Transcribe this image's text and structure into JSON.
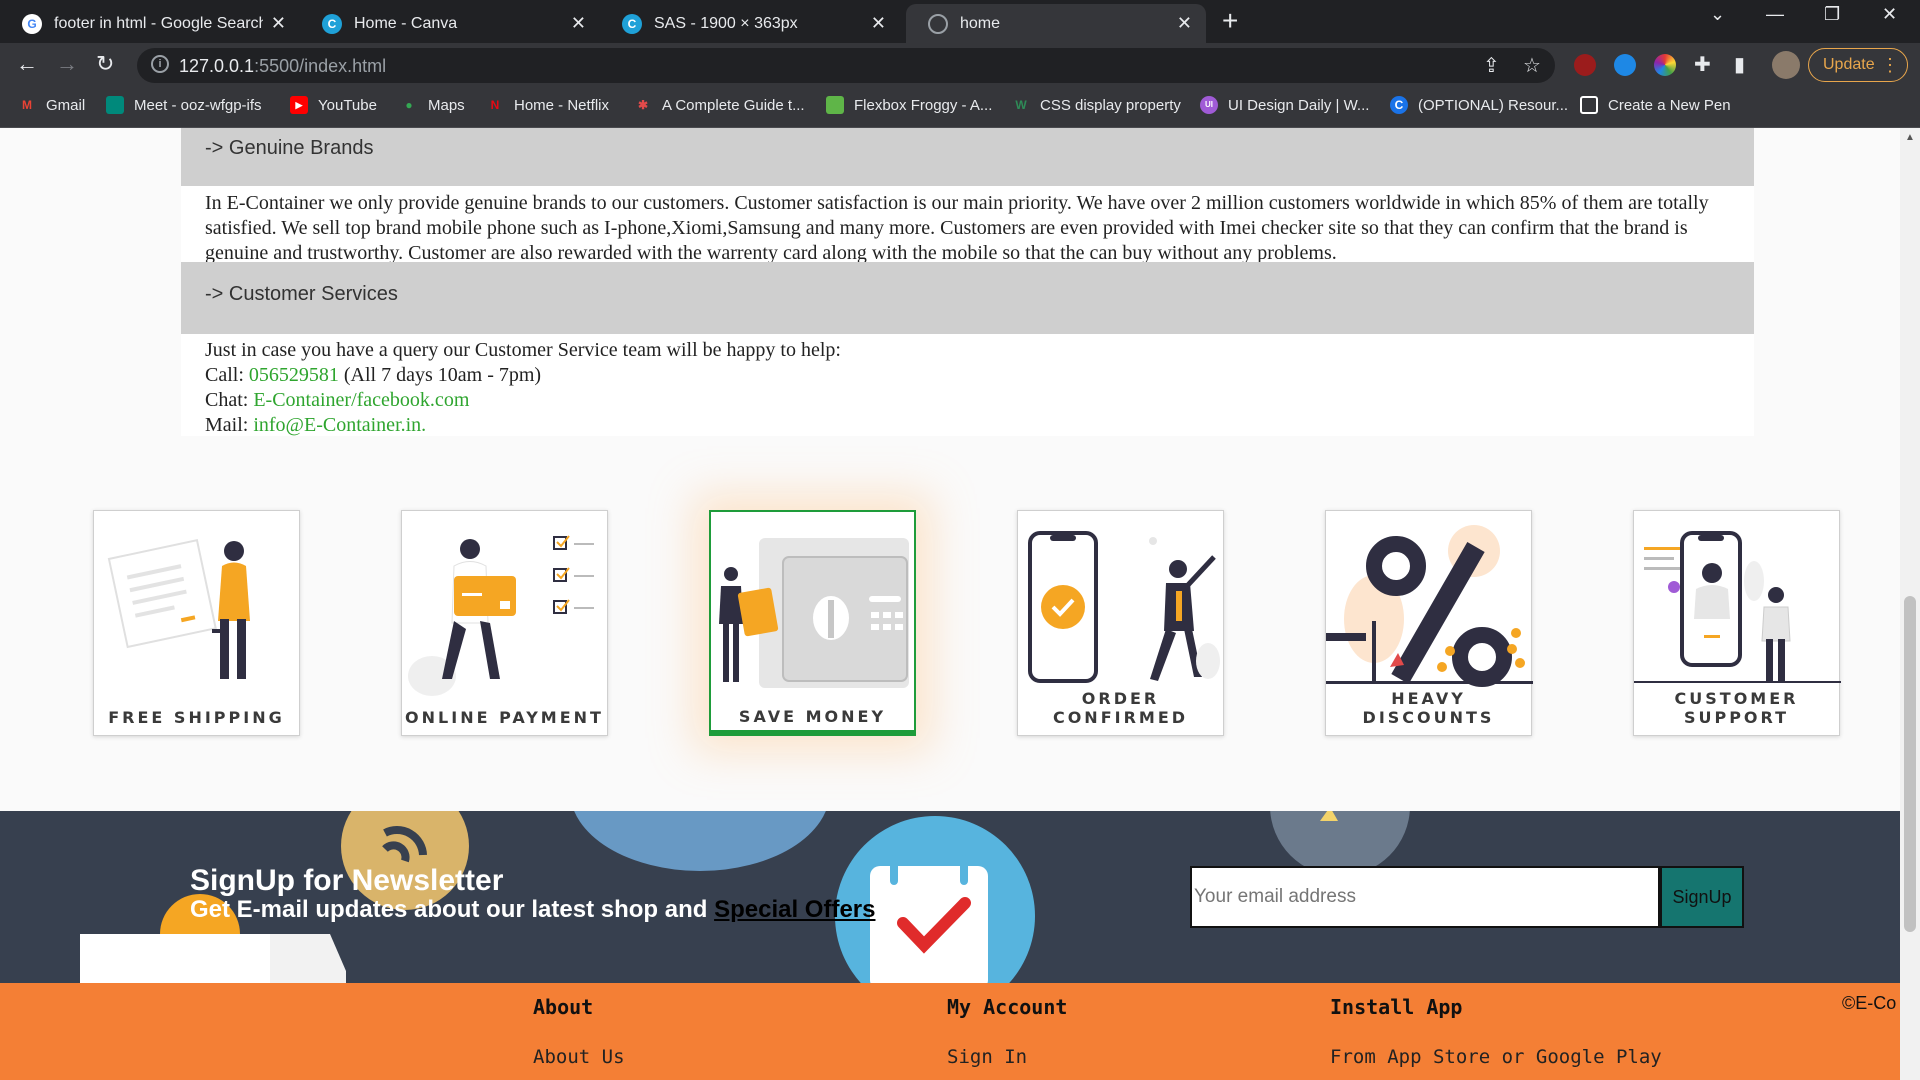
{
  "browser": {
    "tabs": [
      {
        "title": "footer in html - Google Search",
        "icon": "google-icon"
      },
      {
        "title": "Home - Canva",
        "icon": "canva-icon"
      },
      {
        "title": "SAS - 1900 × 363px",
        "icon": "canva-icon"
      },
      {
        "title": "home",
        "icon": "globe-icon",
        "active": true
      }
    ],
    "url_host": "127.0.0.1",
    "url_rest": ":5500/index.html",
    "update_label": "Update",
    "bookmarks": [
      {
        "label": "Gmail",
        "icon": "gmail-icon",
        "color": "#ea4335"
      },
      {
        "label": "Meet - ooz-wfgp-ifs",
        "icon": "meet-icon",
        "color": "#00897b"
      },
      {
        "label": "YouTube",
        "icon": "youtube-icon",
        "color": "#ff0000"
      },
      {
        "label": "Maps",
        "icon": "maps-icon",
        "color": "#34a853"
      },
      {
        "label": "Home - Netflix",
        "icon": "netflix-icon",
        "color": "#e50914"
      },
      {
        "label": "A Complete Guide t...",
        "icon": "asterisk-icon",
        "color": "#e24a4a"
      },
      {
        "label": "Flexbox Froggy - A...",
        "icon": "frog-icon",
        "color": "#5fb548"
      },
      {
        "label": "CSS display property",
        "icon": "w-icon",
        "color": "#2e8b57"
      },
      {
        "label": "UI Design Daily | W...",
        "icon": "ui-icon",
        "color": "#a05bd6"
      },
      {
        "label": "(OPTIONAL) Resour...",
        "icon": "c-icon",
        "color": "#1a73e8"
      },
      {
        "label": "Create a New Pen",
        "icon": "codepen-icon",
        "color": "#ffffff"
      }
    ]
  },
  "faq": {
    "genuine": {
      "title": "-> Genuine Brands",
      "body": "In E-Container we only provide genuine brands to our customers. Customer satisfaction is our main priority. We have over 2 million customers worldwide in which 85% of them are totally satisfied. We sell top brand mobile phone such as I-phone,Xiomi,Samsung and many more. Customers are even provided with Imei checker site so that they can confirm that the brand is genuine and trustworthy. Customer are also rewarded with the warrenty card along with the mobile so that the can buy without any problems."
    },
    "services": {
      "title": "-> Customer Services",
      "intro": "Just in case you have a query our Customer Service team will be happy to help:",
      "call_label": "Call:",
      "call_number": "056529581",
      "call_hours": "(All 7 days 10am - 7pm)",
      "chat_label": "Chat:",
      "chat_link": "E-Container/facebook.com",
      "mail_label": "Mail:",
      "mail_link": "info@E-Container.in."
    }
  },
  "features": [
    {
      "label": "FREE SHIPPING"
    },
    {
      "label": "ONLINE PAYMENT"
    },
    {
      "label": "SAVE MONEY",
      "featured": true
    },
    {
      "label": "ORDER CONFIRMED"
    },
    {
      "label": "HEAVY DISCOUNTS"
    },
    {
      "label": "CUSTOMER SUPPORT"
    }
  ],
  "newsletter": {
    "title": "SignUp for Newsletter",
    "subtitle": "Get E-mail updates about our latest shop and",
    "offers_link": "Special Offers",
    "email_placeholder": "Your email address",
    "button_label": "SignUp"
  },
  "footer": {
    "columns": [
      {
        "heading": "About",
        "link": "About Us"
      },
      {
        "heading": "My Account",
        "link": "Sign In"
      },
      {
        "heading": "Install App",
        "link": "From App Store or Google Play"
      }
    ],
    "copyright": "©E-Co"
  },
  "colors": {
    "accent_green": "#2fa52f",
    "newsletter_bg": "#37404f",
    "footer_bg": "#f47f35",
    "signup_btn": "#15756f"
  }
}
